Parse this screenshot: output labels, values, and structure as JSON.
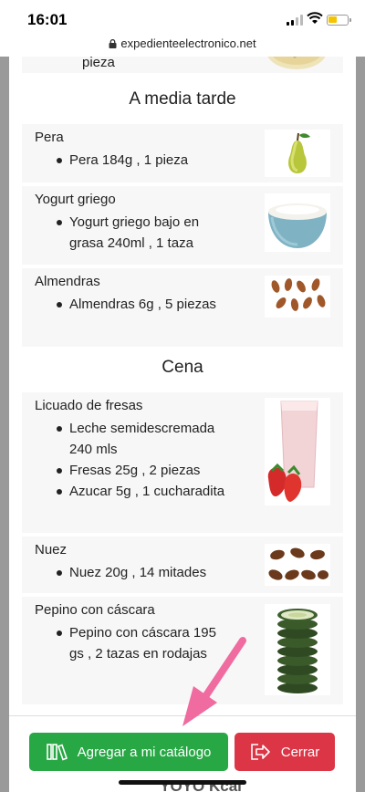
{
  "status": {
    "time": "16:01"
  },
  "browser": {
    "url": "expedienteelectronico.net"
  },
  "previous": {
    "cut_text": "pieza"
  },
  "sections": [
    {
      "title": "A media tarde",
      "items": [
        {
          "name": "Pera",
          "details": [
            "Pera 184g , 1 pieza"
          ]
        },
        {
          "name": "Yogurt griego",
          "details": [
            "Yogurt griego bajo en grasa 240ml , 1 taza"
          ]
        },
        {
          "name": "Almendras",
          "details": [
            "Almendras 6g , 5 piezas"
          ]
        }
      ]
    },
    {
      "title": "Cena",
      "items": [
        {
          "name": "Licuado de fresas",
          "details": [
            "Leche semidescremada 240 mls",
            "Fresas 25g , 2 piezas",
            "Azucar 5g , 1 cucharadita"
          ]
        },
        {
          "name": "Nuez",
          "details": [
            "Nuez 20g , 14 mitades"
          ]
        },
        {
          "name": "Pepino con cáscara",
          "details": [
            "Pepino con cáscara 195 gs , 2 tazas en rodajas"
          ]
        }
      ]
    }
  ],
  "footer": {
    "add_label": "Agregar a mi catálogo",
    "close_label": "Cerrar"
  },
  "background_peek": "YOYO Kcal",
  "icons": {
    "add": "catalog-books-icon",
    "close": "exit-door-icon"
  },
  "colors": {
    "add_button": "#28a745",
    "close_button": "#dc3545",
    "annotation_arrow": "#f06ba0"
  }
}
